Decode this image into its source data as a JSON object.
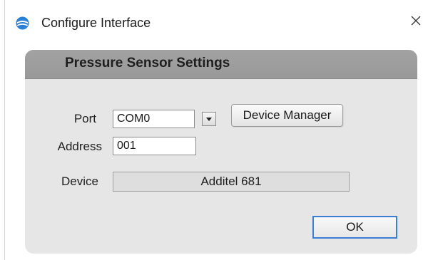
{
  "window": {
    "title": "Configure Interface",
    "icon": "app-logo-icon",
    "close_icon": "close-icon"
  },
  "panel": {
    "title": "Pressure Sensor Settings"
  },
  "form": {
    "port_label": "Port",
    "port_value": "COM0",
    "dropdown_icon": "chevron-down-icon",
    "device_manager_label": "Device Manager",
    "address_label": "Address",
    "address_value": "001",
    "device_label": "Device",
    "device_value": "Additel 681"
  },
  "actions": {
    "ok_label": "OK"
  },
  "colors": {
    "accent": "#3c7fd2",
    "header": "#9e9e9e",
    "panel": "#e6e6e6"
  }
}
